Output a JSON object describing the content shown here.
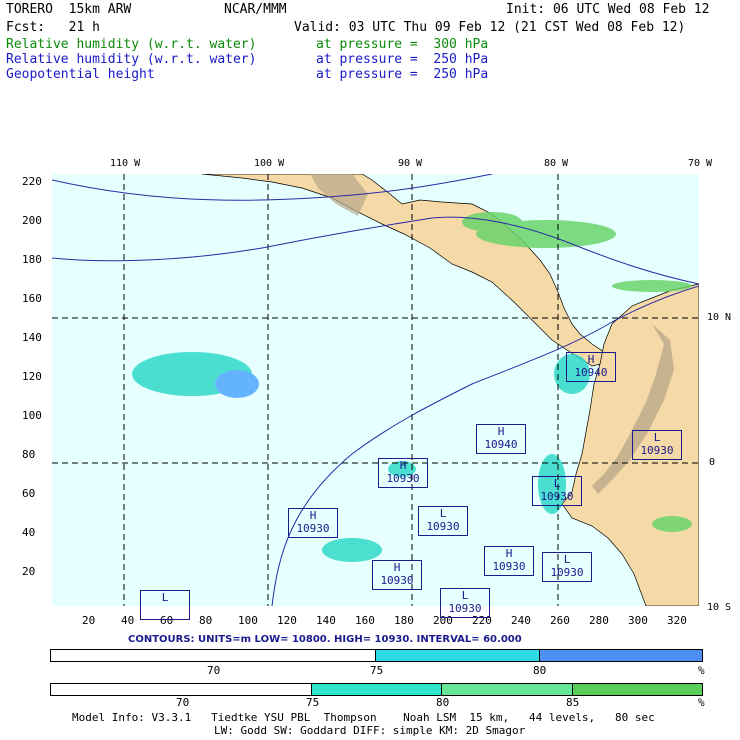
{
  "header": {
    "model": "TORERO  15km ARW",
    "org": "NCAR/MMM",
    "init": "Init: 06 UTC Wed 08 Feb 12",
    "fcst": "Fcst:   21 h",
    "valid": "Valid: 03 UTC Thu 09 Feb 12 (21 CST Wed 08 Feb 12)",
    "fields": [
      {
        "name": "Relative humidity (w.r.t. water)",
        "level": "at pressure =  300 hPa",
        "color": "#0a8a0a"
      },
      {
        "name": "Relative humidity (w.r.t. water)",
        "level": "at pressure =  250 hPa",
        "color": "#1a1ac8"
      },
      {
        "name": "Geopotential height",
        "level": "at pressure =  250 hPa",
        "color": "#1a1ac8"
      }
    ]
  },
  "map": {
    "lon_labels": [
      "110 W",
      "100 W",
      "90 W",
      "80 W",
      "70 W"
    ],
    "lat_labels": [
      "10 N",
      "0",
      "10 S"
    ],
    "y_ticks": [
      "220",
      "200",
      "180",
      "160",
      "140",
      "120",
      "100",
      "80",
      "60",
      "40",
      "20"
    ],
    "x_ticks": [
      "20",
      "40",
      "60",
      "80",
      "100",
      "120",
      "140",
      "160",
      "180",
      "200",
      "220",
      "240",
      "260",
      "280",
      "300",
      "320"
    ],
    "colors": {
      "ocean": "#e6ffff",
      "land": "#f5d9a6",
      "rh70": "#2fd9c8",
      "rh80": "#4da6ff",
      "rh85": "#6ad46a"
    },
    "centers": [
      {
        "type": "H",
        "value": "10940"
      },
      {
        "type": "H",
        "value": "10940"
      },
      {
        "type": "L",
        "value": "10930"
      },
      {
        "type": "H",
        "value": "10930"
      },
      {
        "type": "L",
        "value": "10930"
      },
      {
        "type": "H",
        "value": "10930"
      },
      {
        "type": "L",
        "value": "10930"
      },
      {
        "type": "L",
        "value": "10930"
      },
      {
        "type": "H",
        "value": "10930"
      },
      {
        "type": "H",
        "value": "10930"
      },
      {
        "type": "L",
        "value": "10930"
      },
      {
        "type": "L",
        "value": ""
      }
    ]
  },
  "contours_line": "CONTOURS: UNITS=m  LOW= 10800.     HIGH= 10930.    INTERVAL=  60.000",
  "bar1": {
    "labels": [
      "70",
      "75",
      "80"
    ],
    "unit": "%",
    "colors": [
      "#ffffff",
      "#2fd9e6",
      "#4d8ff2"
    ]
  },
  "bar2": {
    "labels": [
      "70",
      "75",
      "80",
      "85"
    ],
    "unit": "%",
    "colors": [
      "#ffffff",
      "#2fe6cc",
      "#66e699",
      "#5acc5a"
    ]
  },
  "model_info1": "Model Info: V3.3.1   Tiedtke YSU PBL  Thompson    Noah LSM  15 km,   44 levels,   80 sec",
  "model_info2": "LW: Godd SW: Goddard DIFF: simple KM: 2D Smagor"
}
